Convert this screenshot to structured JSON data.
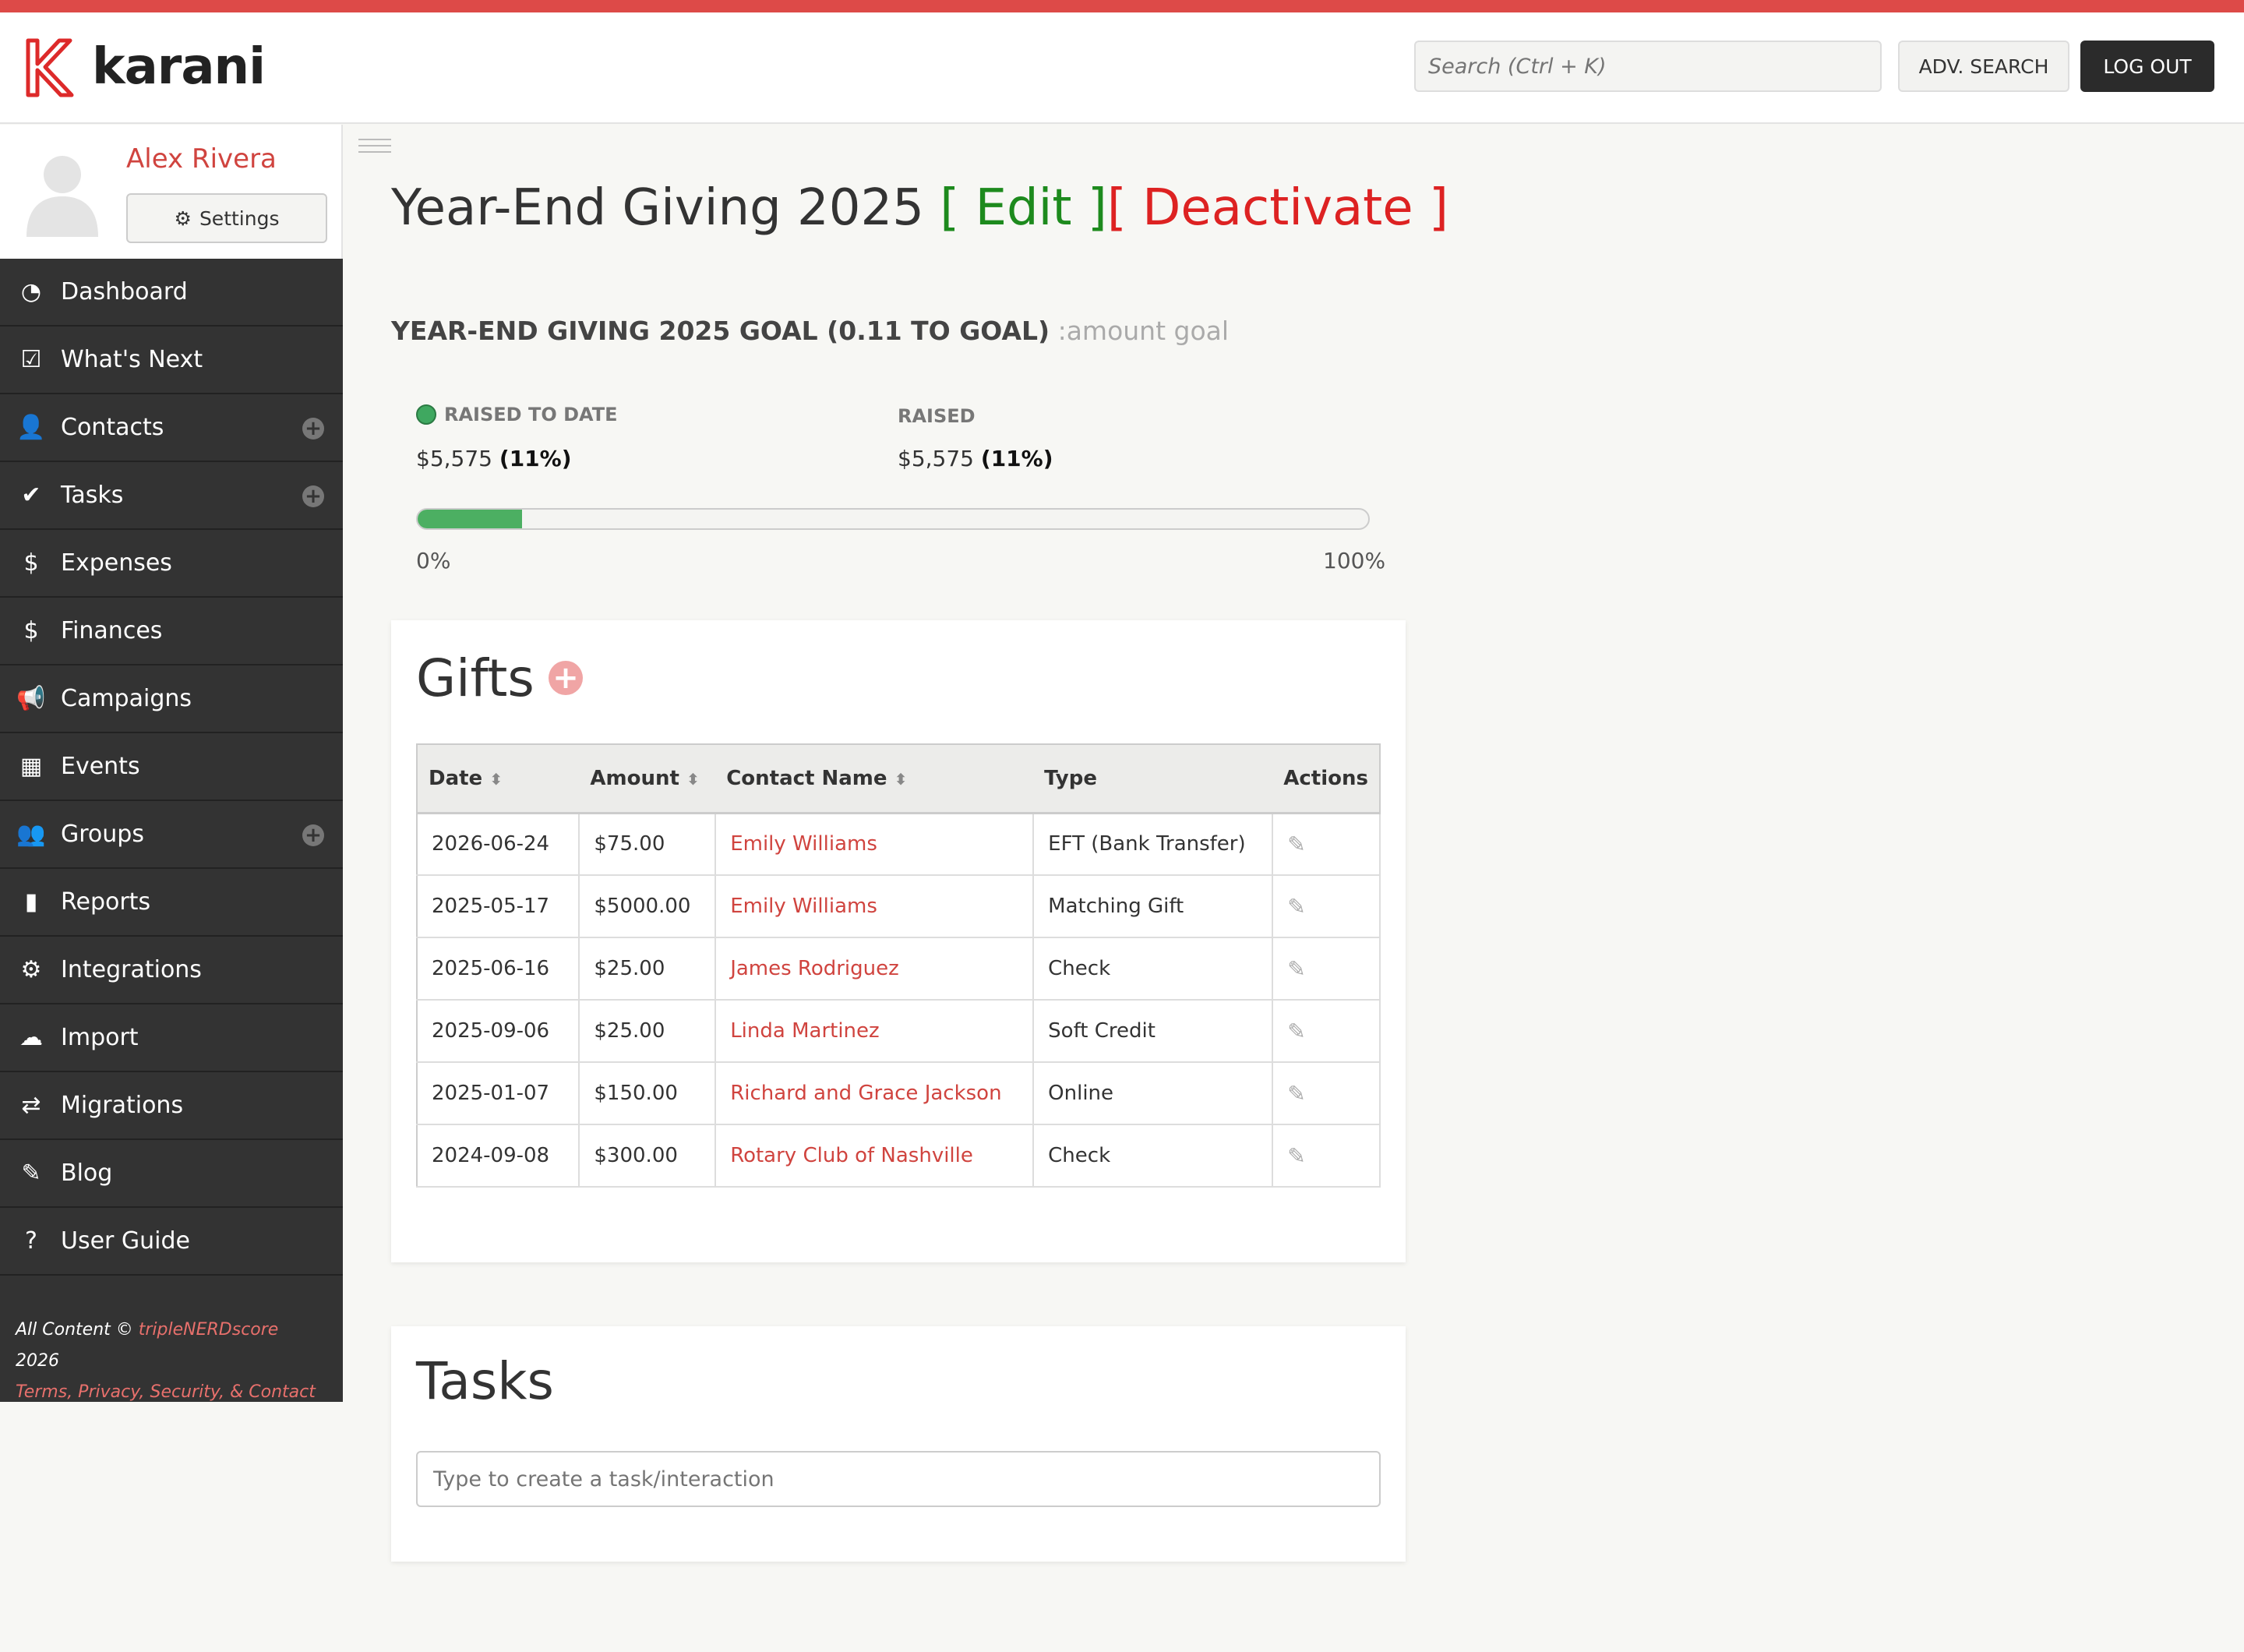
{
  "app": {
    "name": "karani",
    "accent": "#dd4a48"
  },
  "header": {
    "search_placeholder": "Search (Ctrl + K)",
    "adv_search_label": "ADV. SEARCH",
    "logout_label": "LOG OUT"
  },
  "profile": {
    "name": "Alex Rivera",
    "settings_label": "Settings"
  },
  "sidebar": {
    "items": [
      {
        "label": "Dashboard",
        "icon": "dashboard-icon",
        "has_add": false
      },
      {
        "label": "What's Next",
        "icon": "checkbox-icon",
        "has_add": false
      },
      {
        "label": "Contacts",
        "icon": "user-icon",
        "has_add": true
      },
      {
        "label": "Tasks",
        "icon": "check-icon",
        "has_add": true
      },
      {
        "label": "Expenses",
        "icon": "dollar-icon",
        "has_add": false
      },
      {
        "label": "Finances",
        "icon": "dollar-icon",
        "has_add": false
      },
      {
        "label": "Campaigns",
        "icon": "megaphone-icon",
        "has_add": false
      },
      {
        "label": "Events",
        "icon": "calendar-icon",
        "has_add": false
      },
      {
        "label": "Groups",
        "icon": "group-icon",
        "has_add": true
      },
      {
        "label": "Reports",
        "icon": "bar-chart-icon",
        "has_add": false
      },
      {
        "label": "Integrations",
        "icon": "gear-icon",
        "has_add": false
      },
      {
        "label": "Import",
        "icon": "upload-icon",
        "has_add": false
      },
      {
        "label": "Migrations",
        "icon": "swap-icon",
        "has_add": false
      },
      {
        "label": "Blog",
        "icon": "pencil-icon",
        "has_add": false
      },
      {
        "label": "User Guide",
        "icon": "help-icon",
        "has_add": false
      }
    ],
    "footer": {
      "copyright_prefix": "All Content © ",
      "company": "tripleNERDscore",
      "year": " 2026",
      "links": "Terms, Privacy, Security, & Contact"
    }
  },
  "campaign": {
    "title": "Year-End Giving 2025",
    "edit_label": "[ Edit ]",
    "deactivate_label": "[ Deactivate ]",
    "goal_heading": "YEAR-END GIVING 2025 GOAL (0.11 TO GOAL)",
    "goal_sub": " :amount goal",
    "raised_to_date_label": "RAISED TO DATE",
    "raised_to_date_value": "$5,575",
    "raised_to_date_pct": "(11%)",
    "raised_label": "RAISED",
    "raised_value": "$5,575",
    "raised_pct": "(11%)",
    "progress_fraction": 0.11,
    "progress_min_label": "0%",
    "progress_max_label": "100%"
  },
  "gifts": {
    "title": "Gifts",
    "columns": {
      "date": "Date",
      "amount": "Amount",
      "contact": "Contact Name",
      "type": "Type",
      "actions": "Actions"
    },
    "rows": [
      {
        "date": "2026-06-24",
        "amount": "$75.00",
        "contact": "Emily Williams",
        "type": "EFT (Bank Transfer)"
      },
      {
        "date": "2025-05-17",
        "amount": "$5000.00",
        "contact": "Emily Williams",
        "type": "Matching Gift"
      },
      {
        "date": "2025-06-16",
        "amount": "$25.00",
        "contact": "James Rodriguez",
        "type": "Check"
      },
      {
        "date": "2025-09-06",
        "amount": "$25.00",
        "contact": "Linda Martinez",
        "type": "Soft Credit"
      },
      {
        "date": "2025-01-07",
        "amount": "$150.00",
        "contact": "Richard and Grace Jackson",
        "type": "Online"
      },
      {
        "date": "2024-09-08",
        "amount": "$300.00",
        "contact": "Rotary Club of Nashville",
        "type": "Check"
      }
    ]
  },
  "tasks": {
    "title": "Tasks",
    "input_placeholder": "Type to create a task/interaction"
  }
}
